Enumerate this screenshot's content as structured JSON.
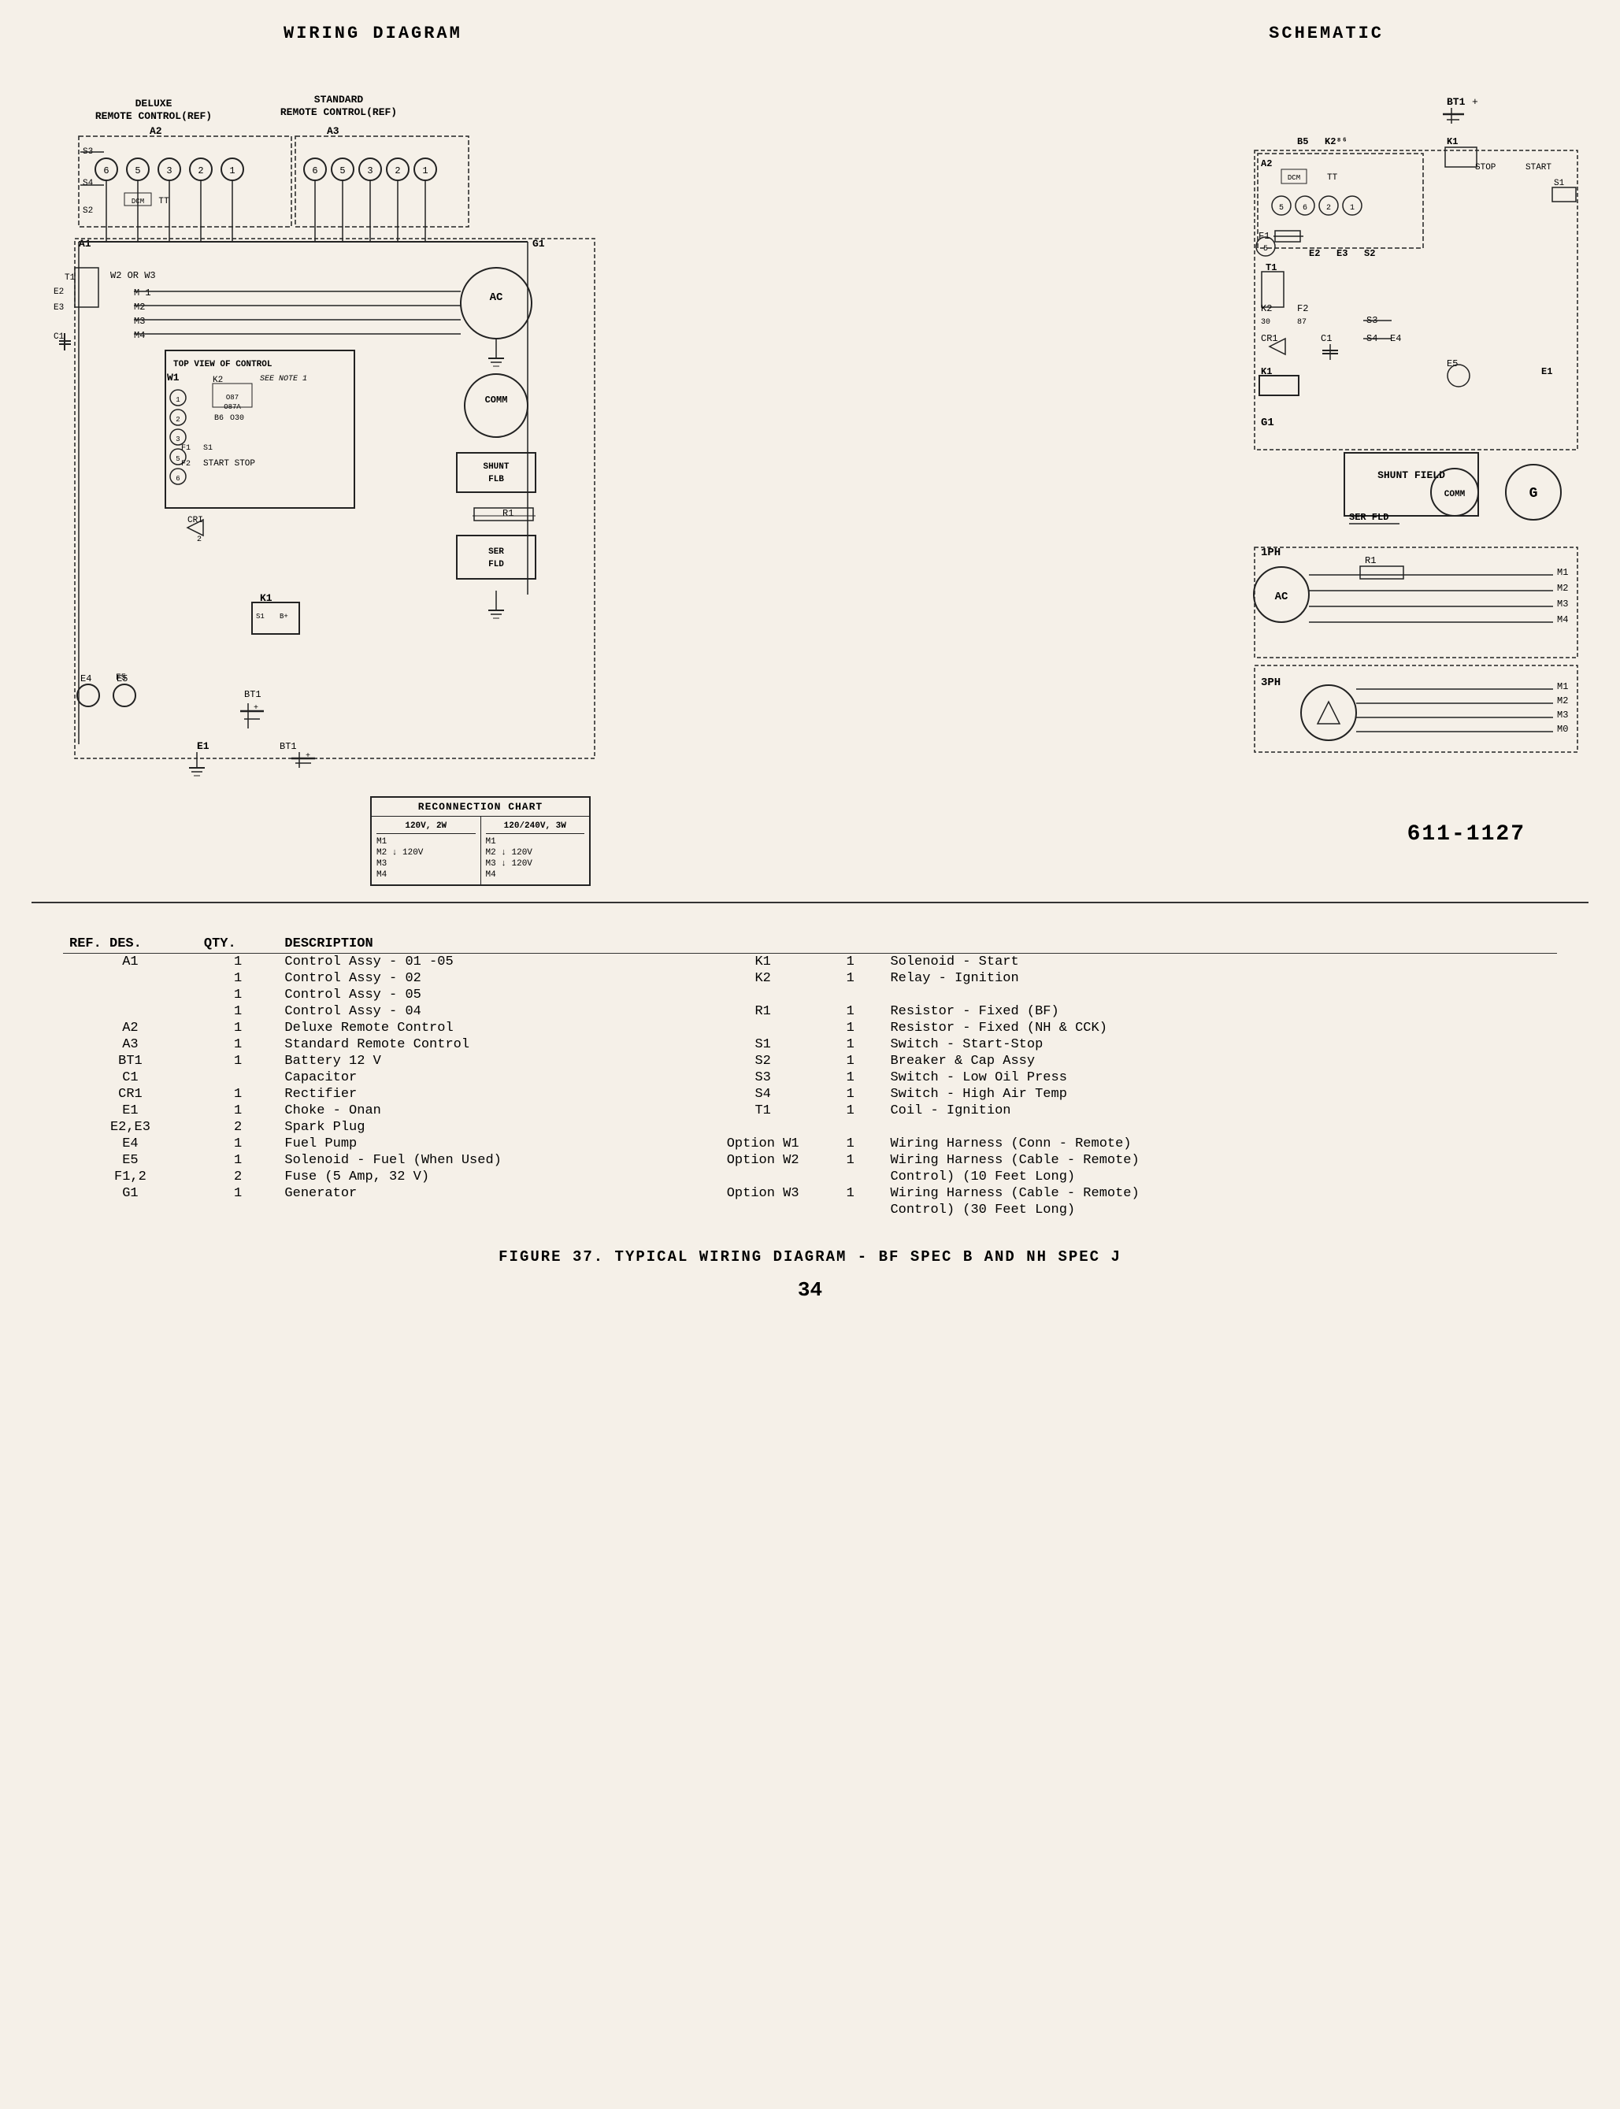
{
  "page": {
    "title_wiring": "WIRING  DIAGRAM",
    "title_schematic": "SCHEMATIC",
    "part_number": "611-1127",
    "reconnection": {
      "title": "RECONNECTION CHART",
      "col1_title": "120V, 2W",
      "col2_title": "120/240V, 3W",
      "col1_items": [
        "M1",
        "M2 ⬇ 120V",
        "M3",
        "M4"
      ],
      "col2_items": [
        "M1",
        "M2 ⬇ 120V",
        "M3 ⬇ 120V",
        "M4"
      ]
    },
    "figure_caption": "FIGURE 37. TYPICAL WIRING DIAGRAM - BF SPEC B AND NH SPEC J",
    "page_number": "34",
    "labels": {
      "deluxe_remote": "DELUXE\nREMOTE CONTROL(REF)",
      "standard_remote": "STANDARD\nREMOTE CONTROL(REF)",
      "a2_label": "A2",
      "a3_label": "A3",
      "a1_label": "A1",
      "g1_label": "G1",
      "top_view": "TOP VIEW OF CONTROL",
      "see_note": "SEE NOTE 1",
      "comm": "COMM",
      "shunt_flb": "SHUNT\nFLB",
      "ser_fld": "SER\nFLD",
      "r1": "R1",
      "start_stop": "START STOP",
      "bt1_label": "BT1",
      "e1_label": "E1",
      "shunt_field": "SHUNT FIELD",
      "ser_fld2": "SER FLD",
      "iph": "1PH",
      "3ph": "3PH",
      "ac": "AC",
      "stop_start": "STOP  START",
      "k1": "K1",
      "b5": "B5",
      "k286": "K2⁸⁶",
      "dcm": "DCM",
      "tt": "TT"
    },
    "parts_table": {
      "headers": [
        "REF. DES.",
        "QTY.",
        "DESCRIPTION",
        "",
        "",
        ""
      ],
      "rows": [
        {
          "ref": "A1",
          "qty": "1",
          "desc": "Control Assy - 01 -05",
          "ref2": "K1",
          "qty2": "1",
          "desc2": "Solenoid - Start"
        },
        {
          "ref": "",
          "qty": "1",
          "desc": "Control Assy - 02",
          "ref2": "K2",
          "qty2": "1",
          "desc2": "Relay - Ignition"
        },
        {
          "ref": "",
          "qty": "1",
          "desc": "Control Assy - 05",
          "ref2": "",
          "qty2": "",
          "desc2": ""
        },
        {
          "ref": "",
          "qty": "1",
          "desc": "Control Assy - 04",
          "ref2": "R1",
          "qty2": "1",
          "desc2": "Resistor - Fixed (BF)"
        },
        {
          "ref": "A2",
          "qty": "1",
          "desc": "Deluxe Remote Control",
          "ref2": "",
          "qty2": "1",
          "desc2": "Resistor - Fixed (NH & CCK)"
        },
        {
          "ref": "A3",
          "qty": "1",
          "desc": "Standard Remote Control",
          "ref2": "S1",
          "qty2": "1",
          "desc2": "Switch - Start-Stop"
        },
        {
          "ref": "BT1",
          "qty": "1",
          "desc": "Battery 12 V",
          "ref2": "S2",
          "qty2": "1",
          "desc2": "Breaker & Cap Assy"
        },
        {
          "ref": "C1",
          "qty": "",
          "desc": "Capacitor",
          "ref2": "S3",
          "qty2": "1",
          "desc2": "Switch - Low Oil Press"
        },
        {
          "ref": "CR1",
          "qty": "1",
          "desc": "Rectifier",
          "ref2": "S4",
          "qty2": "1",
          "desc2": "Switch - High Air Temp"
        },
        {
          "ref": "E1",
          "qty": "1",
          "desc": "Choke - Onan",
          "ref2": "T1",
          "qty2": "1",
          "desc2": "Coil - Ignition"
        },
        {
          "ref": "E2,E3",
          "qty": "2",
          "desc": "Spark Plug",
          "ref2": "",
          "qty2": "",
          "desc2": ""
        },
        {
          "ref": "E4",
          "qty": "1",
          "desc": "Fuel Pump",
          "ref2": "Option W1",
          "qty2": "1",
          "desc2": "Wiring Harness (Conn - Remote)"
        },
        {
          "ref": "E5",
          "qty": "1",
          "desc": "Solenoid - Fuel (When Used)",
          "ref2": "Option W2",
          "qty2": "1",
          "desc2": "Wiring Harness (Cable - Remote)"
        },
        {
          "ref": "F1,2",
          "qty": "2",
          "desc": "Fuse (5 Amp, 32 V)",
          "ref2": "",
          "qty2": "",
          "desc2": "Control) (10 Feet Long)"
        },
        {
          "ref": "G1",
          "qty": "1",
          "desc": "Generator",
          "ref2": "Option W3",
          "qty2": "1",
          "desc2": "Wiring Harness (Cable - Remote)"
        },
        {
          "ref": "",
          "qty": "",
          "desc": "",
          "ref2": "",
          "qty2": "",
          "desc2": "Control) (30 Feet Long)"
        }
      ]
    }
  }
}
